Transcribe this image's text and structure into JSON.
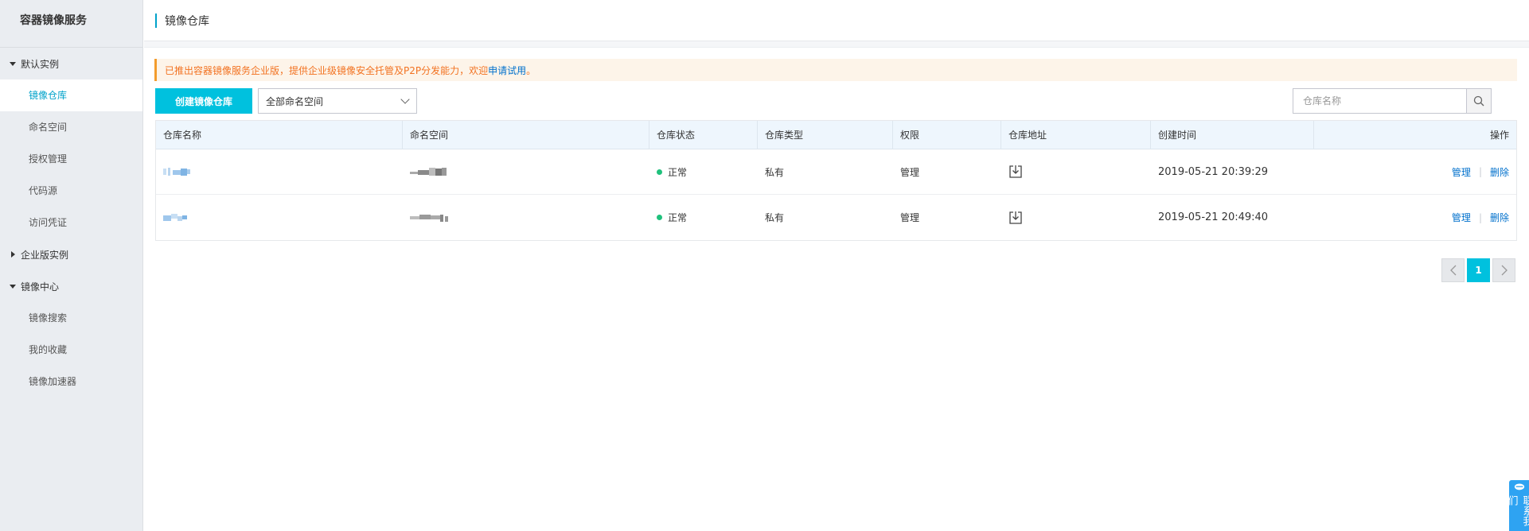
{
  "sidebar": {
    "title": "容器镜像服务",
    "groups": [
      {
        "label": "默认实例",
        "expanded": true,
        "items": [
          "镜像仓库",
          "命名空间",
          "授权管理",
          "代码源",
          "访问凭证"
        ]
      },
      {
        "label": "企业版实例",
        "expanded": false,
        "items": []
      },
      {
        "label": "镜像中心",
        "expanded": true,
        "items": [
          "镜像搜索",
          "我的收藏",
          "镜像加速器"
        ]
      }
    ],
    "active_item": "镜像仓库"
  },
  "header": {
    "title": "镜像仓库"
  },
  "notice": {
    "text": "已推出容器镜像服务企业版，提供企业级镜像安全托管及P2P分发能力，欢迎",
    "link_label": "申请试用",
    "suffix": "。"
  },
  "toolbar": {
    "create_label": "创建镜像仓库",
    "namespace_select": "全部命名空间",
    "search_placeholder": "仓库名称"
  },
  "table": {
    "columns": [
      "仓库名称",
      "命名空间",
      "仓库状态",
      "仓库类型",
      "权限",
      "仓库地址",
      "创建时间",
      "操作"
    ],
    "rows": [
      {
        "name": "",
        "namespace": "",
        "status": "正常",
        "type": "私有",
        "permission": "管理",
        "created": "2019-05-21 20:39:29",
        "action_manage": "管理",
        "action_delete": "删除"
      },
      {
        "name": "",
        "namespace": "",
        "status": "正常",
        "type": "私有",
        "permission": "管理",
        "created": "2019-05-21 20:49:40",
        "action_manage": "管理",
        "action_delete": "删除"
      }
    ]
  },
  "pagination": {
    "current": "1"
  },
  "float_contact": {
    "label": "联系我们"
  },
  "colors": {
    "accent": "#00c1de",
    "link": "#0070cc",
    "status_ok": "#1fc17c",
    "notice_text": "#f27221"
  }
}
